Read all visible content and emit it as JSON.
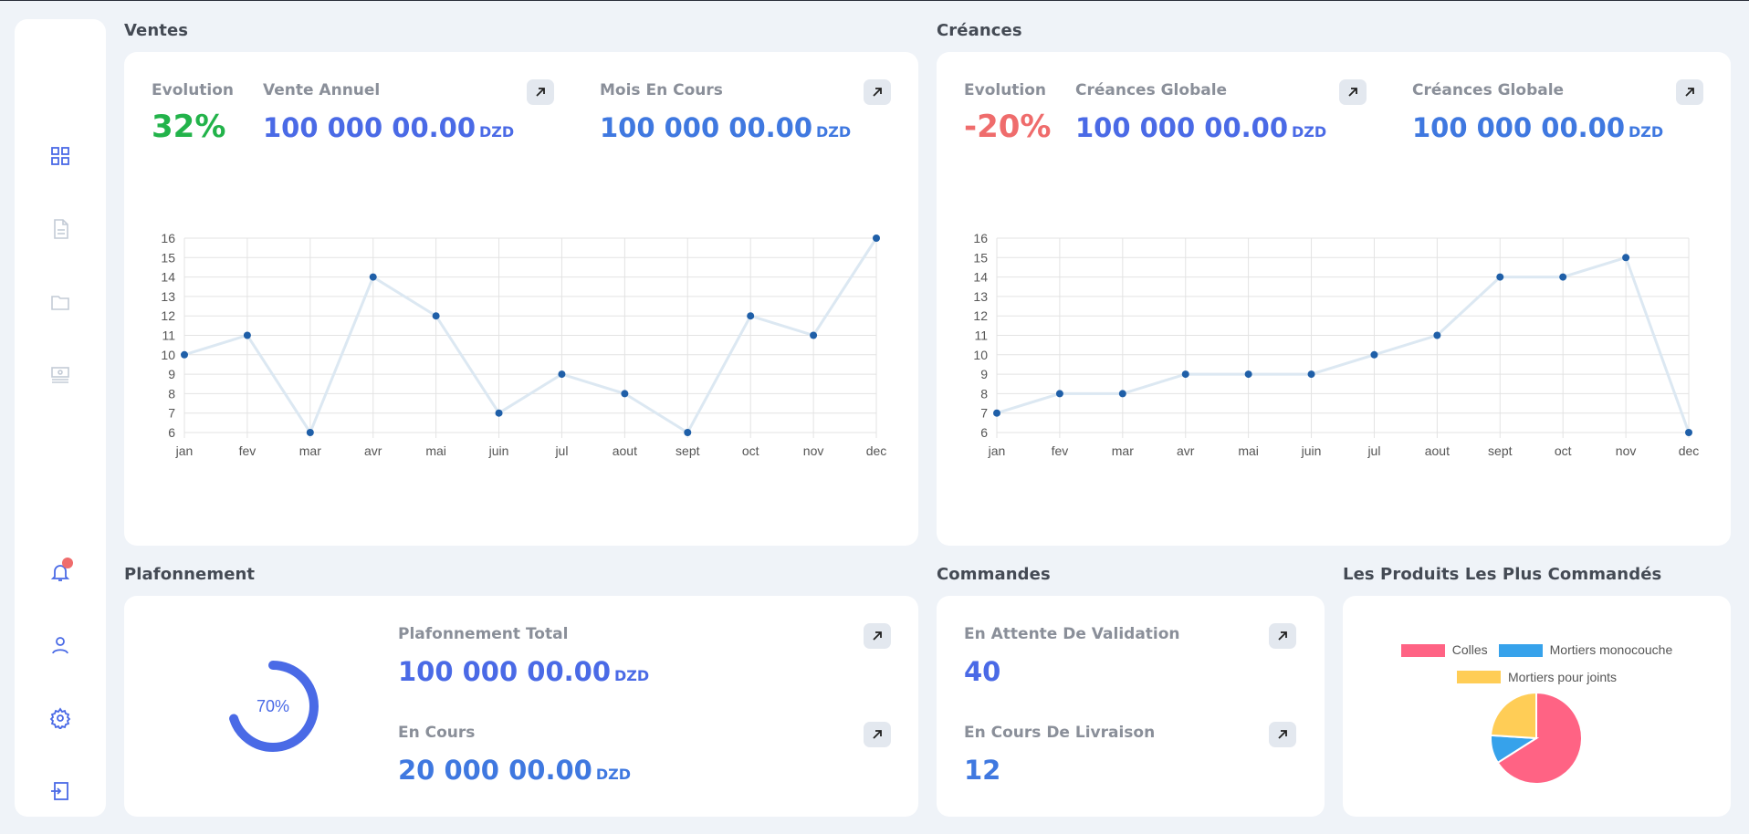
{
  "sidebar": {
    "icons": [
      "dashboard-icon",
      "document-icon",
      "folder-icon",
      "payment-icon",
      "bell-icon",
      "user-icon",
      "settings-icon",
      "logout-icon"
    ]
  },
  "ventes": {
    "title": "Ventes",
    "evolution_label": "Evolution",
    "evolution_value": "32%",
    "annual_label": "Vente Annuel",
    "annual_value": "100 000 00.00",
    "month_label": "Mois En Cours",
    "month_value": "100 000 00.00",
    "currency": "DZD"
  },
  "creances": {
    "title": "Créances",
    "evolution_label": "Evolution",
    "evolution_value": "-20%",
    "global_label": "Créances Globale",
    "global_value": "100 000 00.00",
    "global2_label": "Créances Globale",
    "global2_value": "100 000 00.00",
    "currency": "DZD"
  },
  "plafonnement": {
    "title": "Plafonnement",
    "gauge_percent": 70,
    "gauge_label": "70%",
    "total_label": "Plafonnement Total",
    "total_value": "100 000 00.00",
    "encours_label": "En Cours",
    "encours_value": "20 000 00.00",
    "currency": "DZD"
  },
  "commandes": {
    "title": "Commandes",
    "attente_label": "En Attente De Validation",
    "attente_value": "40",
    "livraison_label": "En Cours De Livraison",
    "livraison_value": "12"
  },
  "produits": {
    "title": "Les Produits Les Plus Commandés"
  },
  "colors": {
    "line": "#dce8f2",
    "point": "#1f5fa8",
    "grid": "#e3e3e3"
  },
  "chart_data": [
    {
      "type": "line",
      "categories": [
        "jan",
        "fev",
        "mar",
        "avr",
        "mai",
        "juin",
        "jul",
        "aout",
        "sept",
        "oct",
        "nov",
        "dec"
      ],
      "values": [
        10,
        11,
        6,
        14,
        12,
        7,
        9,
        8,
        6,
        12,
        11,
        16
      ],
      "ylim": [
        6,
        16
      ],
      "yticks": [
        6,
        7,
        8,
        9,
        10,
        11,
        12,
        13,
        14,
        15,
        16
      ],
      "grid": true
    },
    {
      "type": "line",
      "categories": [
        "jan",
        "fev",
        "mar",
        "avr",
        "mai",
        "juin",
        "jul",
        "aout",
        "sept",
        "oct",
        "nov",
        "dec"
      ],
      "values": [
        7,
        8,
        8,
        9,
        9,
        9,
        10,
        11,
        14,
        14,
        15,
        6
      ],
      "ylim": [
        6,
        16
      ],
      "yticks": [
        6,
        7,
        8,
        9,
        10,
        11,
        12,
        13,
        14,
        15,
        16
      ],
      "grid": true
    },
    {
      "type": "pie",
      "legend_position": "top",
      "labels": [
        "Colles",
        "Mortiers monocouche",
        "Mortiers pour joints"
      ],
      "values": [
        66,
        10,
        24
      ],
      "colors": [
        "#ff6384",
        "#36a2eb",
        "#ffcd56"
      ]
    }
  ]
}
